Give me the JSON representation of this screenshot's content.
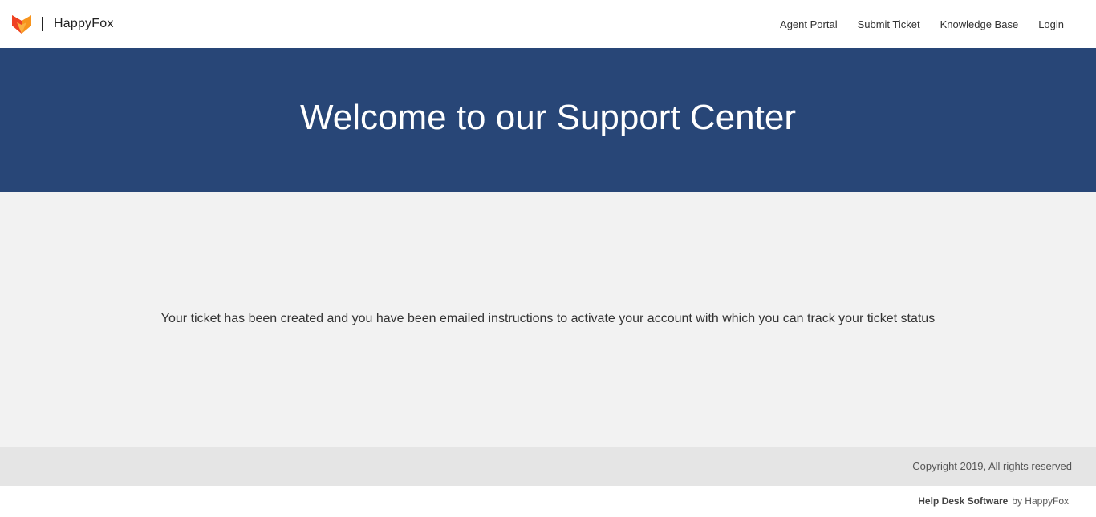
{
  "header": {
    "logo_icon": "fox-logo-icon",
    "brand_name": "HappyFox",
    "nav": [
      {
        "label": "Agent Portal"
      },
      {
        "label": "Submit Ticket"
      },
      {
        "label": "Knowledge Base"
      },
      {
        "label": "Login"
      }
    ]
  },
  "hero": {
    "title": "Welcome to our Support Center",
    "background_color": "#284677"
  },
  "main": {
    "message": "Your ticket has been created and you have been emailed instructions to activate your account with which you can track your ticket status",
    "background_color": "#f2f2f2"
  },
  "footer": {
    "copyright": "Copyright 2019, All rights reserved",
    "powered_link": "Help Desk Software",
    "powered_by": "by HappyFox"
  },
  "colors": {
    "logo_orange": "#f7941d",
    "logo_red": "#ef4123",
    "logo_yellow": "#fbb040"
  }
}
